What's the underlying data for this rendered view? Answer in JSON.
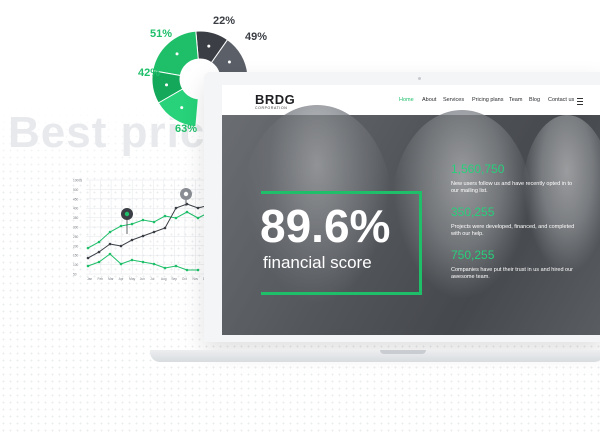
{
  "background": {
    "ghost_heading": "Best pric"
  },
  "donut": {
    "segments": [
      {
        "label": "22%",
        "color": "#3b3f45"
      },
      {
        "label": "49%",
        "color": "#5b6068"
      },
      {
        "label": "51%",
        "color": "#1fbf6a"
      },
      {
        "label": "42%",
        "color": "#14a85a"
      },
      {
        "label": "63%",
        "color": "#27d27a"
      }
    ]
  },
  "line_chart": {
    "y_ticks": [
      "1000$",
      "500",
      "450",
      "400",
      "350",
      "300",
      "250",
      "200",
      "150",
      "100",
      "50"
    ],
    "x_ticks": [
      "Jan",
      "Feb",
      "Mar",
      "Apr",
      "May",
      "Jun",
      "Jul",
      "Aug",
      "Sep",
      "Oct",
      "Nov",
      "Dec"
    ]
  },
  "site": {
    "logo": "BRDG",
    "logo_sub": "CORPORATION",
    "nav": [
      {
        "label": "Home",
        "active": true
      },
      {
        "label": "About",
        "active": false
      },
      {
        "label": "Services",
        "active": false
      },
      {
        "label": "Pricing plans",
        "active": false
      },
      {
        "label": "Team",
        "active": false
      },
      {
        "label": "Blog",
        "active": false
      },
      {
        "label": "Contact us",
        "active": false
      }
    ],
    "hero": {
      "score_value": "89.6%",
      "score_label": "financial score",
      "stats": [
        {
          "value": "1,560,750",
          "text": "New users follow us and have recently opted in to our mailing list."
        },
        {
          "value": "350,255",
          "text": "Projects were developed, financed, and completed with our help."
        },
        {
          "value": "750,255",
          "text": "Companies have put their trust in us and hired our awesome team."
        }
      ]
    }
  },
  "colors": {
    "accent": "#1fbf6a",
    "stat_accent": "#26d07c",
    "dark": "#2a2d32"
  }
}
